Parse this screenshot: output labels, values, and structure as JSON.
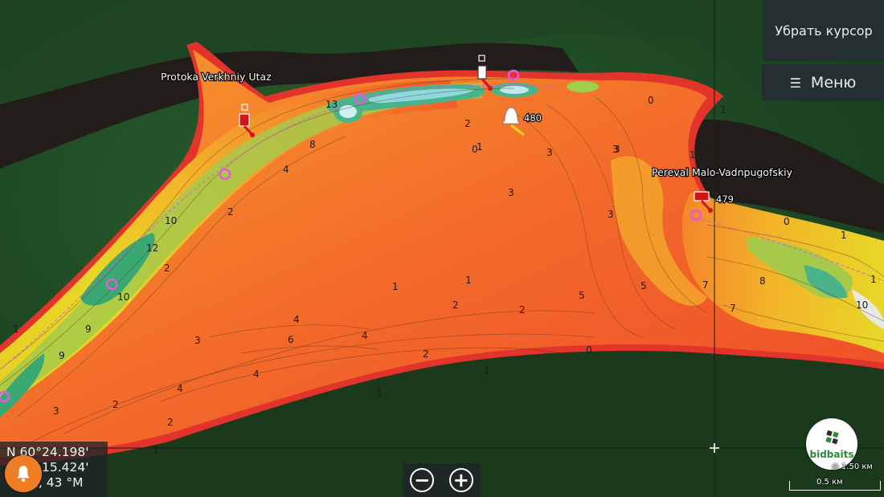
{
  "controls": {
    "cursor_label": "Убрать курсор",
    "menu_label": "Меню"
  },
  "map": {
    "labels": {
      "waypoint_1": "Protoka Verkhniy Utaz",
      "waypoint_2": "Pereval Malo-Vadnpugofskiy",
      "marker_480": "480",
      "marker_479": "479"
    },
    "depths": [
      "13",
      "2",
      "0",
      "1",
      "3",
      "3",
      "8",
      "4",
      "2",
      "10",
      "12",
      "10",
      "9",
      "1",
      "9",
      "2",
      "1",
      "1",
      "3",
      "2",
      "2",
      "4",
      "2",
      "2",
      "1",
      "6",
      "3",
      "4",
      "3",
      "2",
      "3",
      "0",
      "1",
      "1",
      "3",
      "5",
      "5",
      "7",
      "8",
      "7",
      "10",
      "4",
      "0",
      "1",
      "1",
      "1",
      "1",
      "0",
      "4"
    ],
    "colors": {
      "deep": "#3aa872",
      "mid": "#e8d728",
      "shallow": "#f4862a",
      "edge": "#e2342b"
    }
  },
  "coords": {
    "line1": "N  60°24.198'",
    "line2": "15.424'",
    "line3": "2 км, 43 °M"
  },
  "brand": {
    "name": "bidbaits"
  },
  "scale": {
    "zoom_text": "1.50 км",
    "bar_text": "0.5 км"
  }
}
